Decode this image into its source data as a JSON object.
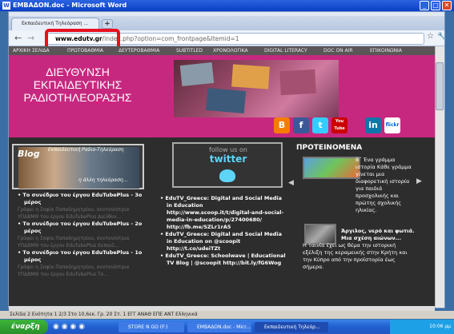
{
  "word_window": {
    "title": "ΕΜΒΑΔΟΝ.doc - Microsoft Word",
    "buttons": [
      "_",
      "□",
      "✕"
    ]
  },
  "browser": {
    "tab_label": "Εκπαιδευτική Τηλεόραση ...",
    "url_host": "www.edutv.gr",
    "url_rest": "/index.php?option=com_frontpage&Itemid=1",
    "icons": {
      "back": "back-arrow-icon",
      "forward": "forward-arrow-icon",
      "bookmark": "star-icon",
      "menu": "wrench-icon"
    }
  },
  "nav": {
    "items": [
      "ΑΡΧΙΚΗ ΣΕΛΙΔΑ",
      "ΠΡΩΤΟΒΑΘΜΙΑ",
      "ΔΕΥΤΕΡΟΒΑΘΜΙΑ",
      "SUBTITLED",
      "ΧΡΟΝΟΛΟΓΙΚΑ",
      "DIGITAL LITERACY",
      "DOC ON AIR",
      "ΕΠΙΚΟΙΝΩΝΙΑ"
    ]
  },
  "banner": {
    "line1": "ΔΙΕΥΘΥΝΣΗ",
    "line2": "ΕΚΠΑΙΔΕΥΤΙΚΗΣ",
    "line3": "ΡΑΔΙΟΤΗΛΕΟΡΑΣΗΣ",
    "social": [
      "blogger-icon",
      "facebook-icon",
      "twitter-icon",
      "youtube-icon",
      "linkedin-icon",
      "flickr-icon"
    ],
    "social_labels": {
      "blogger": "B",
      "facebook": "f",
      "twitter": "t",
      "youtube": "You Tube",
      "linkedin": "in",
      "flickr": "flickr"
    }
  },
  "blog": {
    "caption": "Εκπαιδευτική Ραδιο-Τηλεόραση",
    "blog_word": "Blog",
    "subcaption": "η άλλη τηλεόραση...",
    "items": [
      {
        "title": "Το συνέδριο του έργου EduTubePlus - 3ο μέρος",
        "sub": "Γράφει η Σοφία Παπαδημητρίου, συντονίστρια ΥΠΔΒΜΘ του έργου EduTubePlus Διεύθυν..."
      },
      {
        "title": "Το συνέδριο του έργου EduTubePlus - 2ο μέρος",
        "sub": "Γράφει η Σοφία Παπαδημητρίου, συντονίστρια ΥΠΔΒΜΘ του έργου EduTubePlus Εκπαιδ..."
      },
      {
        "title": "Το συνέδριο του έργου EduTubePlus - 1ο μέρος",
        "sub": "Γράφει η Σοφία Παπαδημητρίου, συντονίστρια ΥΠΔΒΜΘ του έργου EduTubePlus Το..."
      }
    ]
  },
  "twitter": {
    "follow": "follow us on",
    "brand": "twitter",
    "items": [
      "EduTV_Greece: Digital and Social Media in Education http://www.scoop.it/t/digital-and-social-media-in-education/p/27400680/ http://fb.me/SZLr1rA5",
      "EduTV_Greece: Digital and Social Media in Education on @scoopit http://t.co/udeiTZt",
      "EduTV_Greece: Schoolwave | Educational TV Blog | @scoopit http://bit.ly/fG6Wog"
    ]
  },
  "recommended": {
    "title": "ΠΡΟΤΕΙΝΟΜΕΝΑ",
    "item1_text": "Β΄ Ένα γράμμα ιστορία Κάθε γράμμα γίνεται μια διαφορετική ιστορία για παιδιά προσχολικής και πρώτης σχολικής ηλικίας.",
    "item2_title": "Άργιλος, νερό και φωτιά. Μια σχέση αιώνων...",
    "item2_text": "Η ταινία έχει ως θέμα την ιστορική εξέλιξη της κεραμεικής στην Κρήτη και την Κύπρο από την προϊστορία έως σήμερα."
  },
  "statusbar": {
    "text": "Σελίδα 2    Ενότητα 1    2/3    Στο 10,6εκ.  Γρ. 20  Στ. 1        ΕΓΓ  ΑΝΑΘ  ΕΠΕ  ΑΝΤ    Ελληνικά"
  },
  "taskbar": {
    "start": "έναρξη",
    "tasks": [
      "STORE N GO (F:)",
      "ΕΜΒΑΔΟΝ.doc - Micr...",
      "Εκπαιδευτική Τηλεόρ..."
    ],
    "clock": "10:06 μμ"
  }
}
